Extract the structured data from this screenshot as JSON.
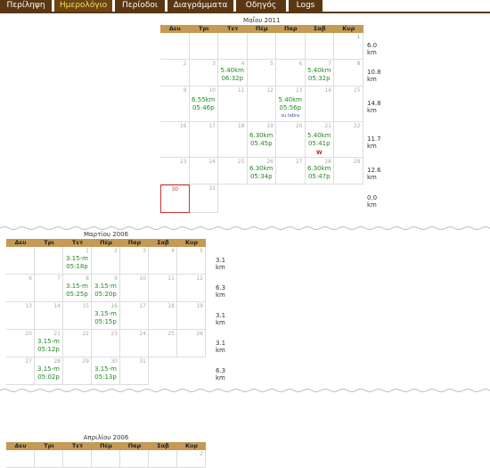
{
  "nav": {
    "tabs": [
      {
        "label": "Περίληψη",
        "active": false
      },
      {
        "label": "Ημερολόγιο",
        "active": true
      },
      {
        "label": "Περίοδοι",
        "active": false
      },
      {
        "label": "Διαγράμματα",
        "active": false
      },
      {
        "label": "Οδηγός",
        "active": false
      },
      {
        "label": "Logs",
        "active": false
      }
    ]
  },
  "days": [
    "Δευ",
    "Τρι",
    "Τετ",
    "Πέμ",
    "Παρ",
    "Σαβ",
    "Κυρ"
  ],
  "may": {
    "title": "Μαΐου 2011",
    "weeks": [
      {
        "total": "6.0 km",
        "cells": [
          {
            "d": ""
          },
          {
            "d": ""
          },
          {
            "d": ""
          },
          {
            "d": ""
          },
          {
            "d": ""
          },
          {
            "d": ""
          },
          {
            "d": "1"
          }
        ]
      },
      {
        "total": "10.8 km",
        "cells": [
          {
            "d": "2"
          },
          {
            "d": "3"
          },
          {
            "d": "4",
            "run": [
              "5.40km",
              "06:32p"
            ]
          },
          {
            "d": "5"
          },
          {
            "d": "6"
          },
          {
            "d": "7",
            "run": [
              "5.40km",
              "05:32p"
            ]
          },
          {
            "d": "8"
          }
        ]
      },
      {
        "total": "14.8 km",
        "cells": [
          {
            "d": "9"
          },
          {
            "d": "10",
            "run": [
              "6.55km",
              "05:46p"
            ]
          },
          {
            "d": "11"
          },
          {
            "d": "12"
          },
          {
            "d": "13",
            "run": [
              "5.40km",
              "05:56p"
            ],
            "tag": "su tabra"
          },
          {
            "d": "14"
          },
          {
            "d": "15"
          }
        ]
      },
      {
        "total": "11.7 km",
        "cells": [
          {
            "d": "16"
          },
          {
            "d": "17"
          },
          {
            "d": "18"
          },
          {
            "d": "19",
            "run": [
              "6.30km",
              "05:45p"
            ]
          },
          {
            "d": "20"
          },
          {
            "d": "21",
            "run": [
              "5.40km",
              "05:41p"
            ],
            "w": "W"
          },
          {
            "d": "22"
          }
        ]
      },
      {
        "total": "12.6 km",
        "cells": [
          {
            "d": "23"
          },
          {
            "d": "24"
          },
          {
            "d": "25"
          },
          {
            "d": "26",
            "run": [
              "6.30km",
              "05:34p"
            ]
          },
          {
            "d": "27"
          },
          {
            "d": "28",
            "run": [
              "6.30km",
              "05:47p"
            ]
          },
          {
            "d": "29"
          }
        ]
      },
      {
        "total": "0.0 km",
        "cells": [
          {
            "d": "30",
            "today": true
          },
          {
            "d": "31"
          }
        ]
      }
    ]
  },
  "march": {
    "title": "Μαρτίου 2006",
    "weeks": [
      {
        "total": "3.1 km",
        "cells": [
          {
            "d": ""
          },
          {
            "d": ""
          },
          {
            "d": "1",
            "run": [
              "3.15-m",
              "05:18p"
            ]
          },
          {
            "d": "2"
          },
          {
            "d": "3"
          },
          {
            "d": "4"
          },
          {
            "d": "5"
          }
        ]
      },
      {
        "total": "6.3 km",
        "cells": [
          {
            "d": "6"
          },
          {
            "d": "7"
          },
          {
            "d": "8",
            "run": [
              "3.15-m",
              "05:25p"
            ]
          },
          {
            "d": "9",
            "run": [
              "3.15-m",
              "05:20p"
            ]
          },
          {
            "d": "10"
          },
          {
            "d": "11"
          },
          {
            "d": "12"
          }
        ]
      },
      {
        "total": "3.1 km",
        "cells": [
          {
            "d": "13"
          },
          {
            "d": "14"
          },
          {
            "d": "15"
          },
          {
            "d": "16",
            "run": [
              "3.15-m",
              "05:15p"
            ]
          },
          {
            "d": "17"
          },
          {
            "d": "18"
          },
          {
            "d": "19"
          }
        ]
      },
      {
        "total": "3.1 km",
        "cells": [
          {
            "d": "20"
          },
          {
            "d": "21",
            "run": [
              "3.15-m",
              "05:12p"
            ]
          },
          {
            "d": "22"
          },
          {
            "d": "23"
          },
          {
            "d": "24"
          },
          {
            "d": "25"
          },
          {
            "d": "26"
          }
        ]
      },
      {
        "total": "6.3 km",
        "cells": [
          {
            "d": "27"
          },
          {
            "d": "28",
            "run": [
              "3.15-m",
              "05:02p"
            ]
          },
          {
            "d": "29"
          },
          {
            "d": "30",
            "run": [
              "3.15-m",
              "05:13p"
            ]
          },
          {
            "d": "31"
          }
        ]
      }
    ]
  },
  "april": {
    "title": "Απριλίου 2006",
    "weeks": [
      {
        "total": "",
        "cells": [
          {
            "d": ""
          },
          {
            "d": ""
          },
          {
            "d": ""
          },
          {
            "d": ""
          },
          {
            "d": ""
          },
          {
            "d": ""
          },
          {
            "d": "2"
          }
        ]
      }
    ]
  }
}
